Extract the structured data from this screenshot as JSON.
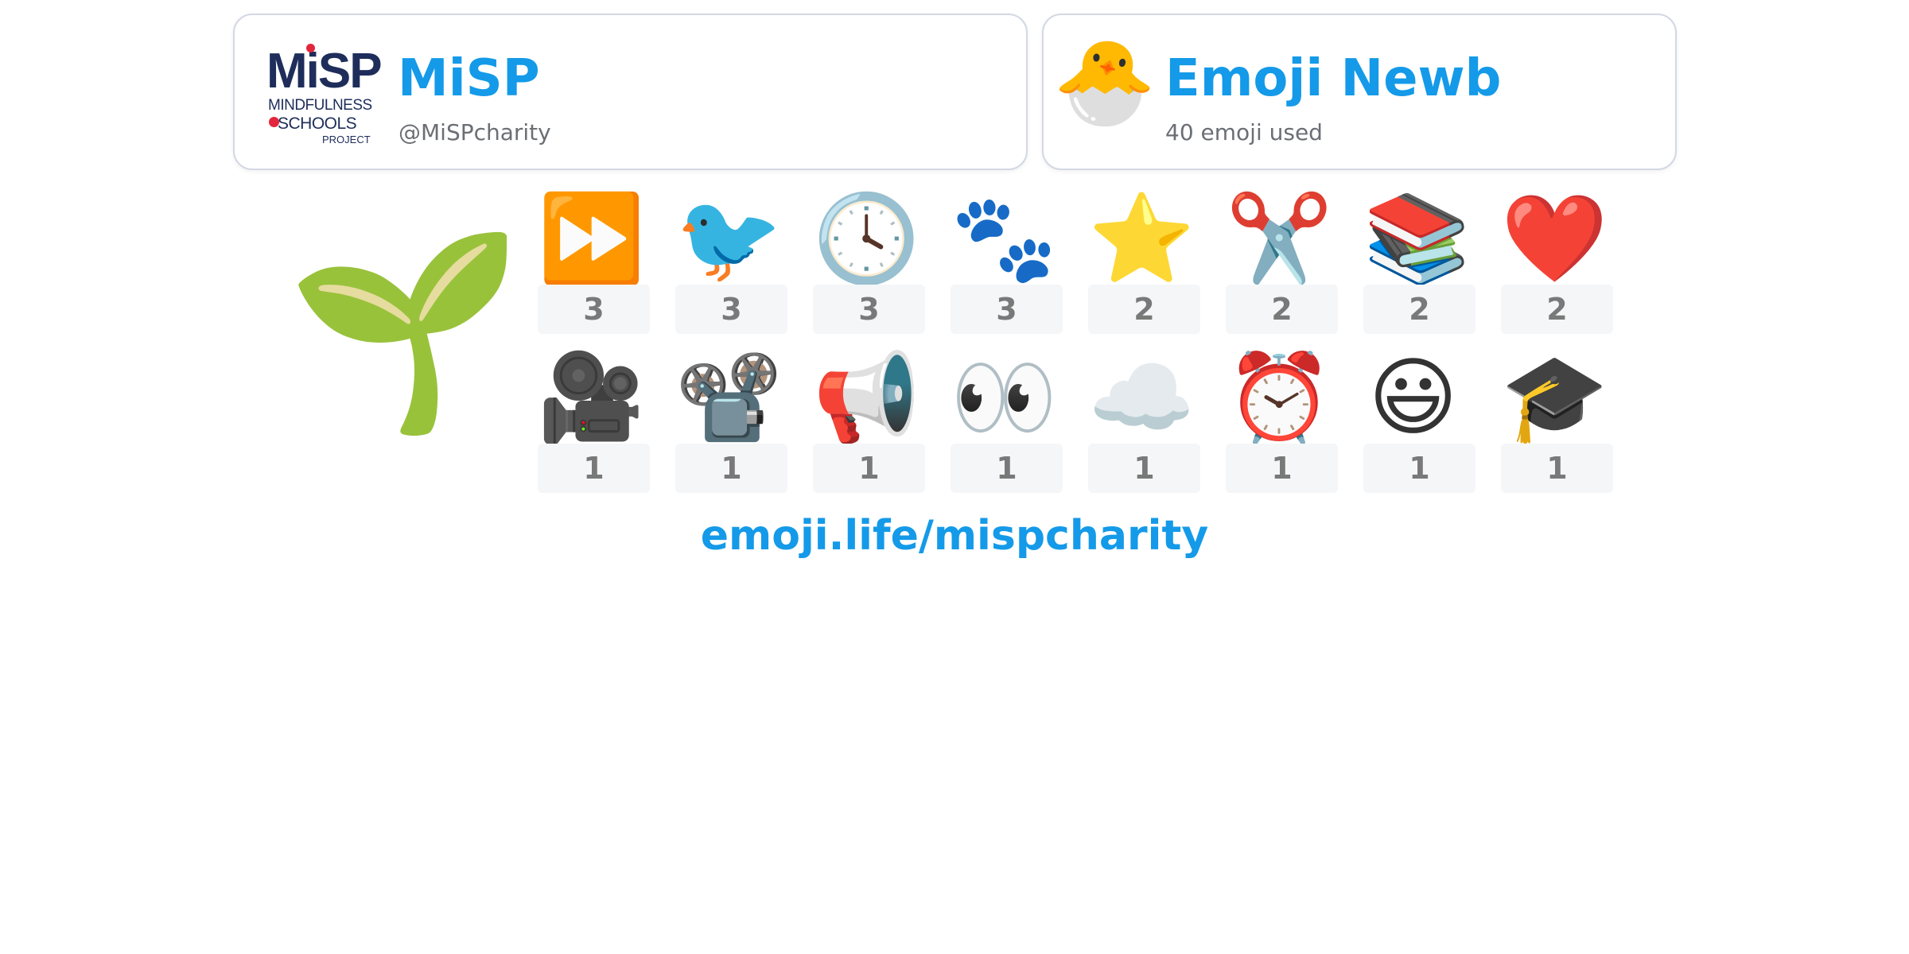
{
  "profile": {
    "name": "MiSP",
    "handle": "@MiSPcharity",
    "logo": {
      "main": "MiSP",
      "line1": "MINDFULNESS",
      "line2": "SCHOOLS",
      "line3": "PROJECT"
    }
  },
  "badge": {
    "icon": "🐣",
    "name": "Emoji Newb",
    "subtitle": "40 emoji used"
  },
  "featured_emoji": "🌱",
  "emoji_stats": [
    {
      "emoji": "⏩",
      "count": "3"
    },
    {
      "emoji": "🐦",
      "count": "3"
    },
    {
      "emoji": "🕓",
      "count": "3"
    },
    {
      "emoji": "🐾",
      "count": "3"
    },
    {
      "emoji": "⭐",
      "count": "2"
    },
    {
      "emoji": "✂️",
      "count": "2"
    },
    {
      "emoji": "📚",
      "count": "2"
    },
    {
      "emoji": "❤️",
      "count": "2"
    },
    {
      "emoji": "🎥",
      "count": "1"
    },
    {
      "emoji": "📽️",
      "count": "1"
    },
    {
      "emoji": "📢",
      "count": "1"
    },
    {
      "emoji": "👀",
      "count": "1"
    },
    {
      "emoji": "☁️",
      "count": "1"
    },
    {
      "emoji": "⏰",
      "count": "1"
    },
    {
      "emoji": "😃",
      "count": "1"
    },
    {
      "emoji": "🎓",
      "count": "1"
    }
  ],
  "footer": {
    "link": "emoji.life/mispcharity"
  },
  "colors": {
    "accent": "#149ae8",
    "logo_navy": "#1e2d5a",
    "logo_red": "#e2263b",
    "count_bg": "#f5f6f8"
  }
}
